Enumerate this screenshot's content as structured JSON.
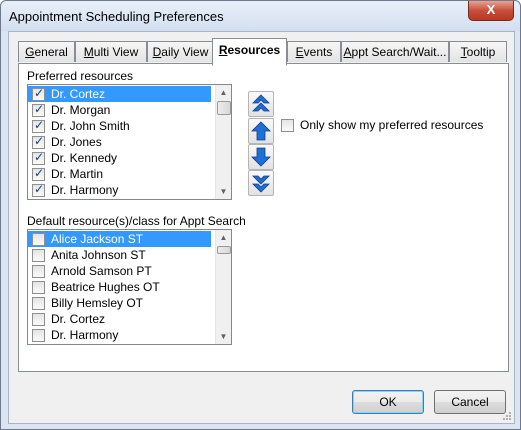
{
  "window": {
    "title": "Appointment Scheduling Preferences",
    "close_label": "X"
  },
  "tabs": [
    {
      "label": "General",
      "underline": "G",
      "rest": "eneral",
      "active": false
    },
    {
      "label": "Multi View",
      "underline": "M",
      "rest": "ulti View",
      "active": false
    },
    {
      "label": "Daily View",
      "underline": "D",
      "rest": "aily View",
      "active": false
    },
    {
      "label": "Resources",
      "underline": "R",
      "rest": "esources",
      "active": true
    },
    {
      "label": "Events",
      "underline": "E",
      "rest": "vents",
      "active": false
    },
    {
      "label": "Appt  Search/Wait...",
      "underline": "A",
      "rest": "ppt  Search/Wait...",
      "active": false
    },
    {
      "label": "Tooltip",
      "underline": "T",
      "rest": "ooltip",
      "active": false
    }
  ],
  "preferred": {
    "label": "Preferred resources",
    "items": [
      {
        "name": "Dr. Cortez",
        "checked": true,
        "selected": true
      },
      {
        "name": "Dr. Morgan",
        "checked": true,
        "selected": false
      },
      {
        "name": "Dr. John Smith",
        "checked": true,
        "selected": false
      },
      {
        "name": "Dr. Jones",
        "checked": true,
        "selected": false
      },
      {
        "name": "Dr. Kennedy",
        "checked": true,
        "selected": false
      },
      {
        "name": "Dr. Martin",
        "checked": true,
        "selected": false
      },
      {
        "name": "Dr. Harmony",
        "checked": true,
        "selected": false
      }
    ]
  },
  "default_resources": {
    "label": "Default resource(s)/class for Appt Search",
    "items": [
      {
        "name": "Alice Jackson ST",
        "checked": false,
        "selected": true
      },
      {
        "name": "Anita Johnson ST",
        "checked": false,
        "selected": false
      },
      {
        "name": "Arnold Samson PT",
        "checked": false,
        "selected": false
      },
      {
        "name": "Beatrice Hughes OT",
        "checked": false,
        "selected": false
      },
      {
        "name": "Billy Hemsley OT",
        "checked": false,
        "selected": false
      },
      {
        "name": "Dr. Cortez",
        "checked": false,
        "selected": false
      },
      {
        "name": "Dr. Harmony",
        "checked": false,
        "selected": false
      }
    ]
  },
  "only_preferred": {
    "label": "Only show my preferred resources",
    "checked": false
  },
  "move_buttons": [
    "move-to-top-icon",
    "move-up-icon",
    "move-down-icon",
    "move-to-bottom-icon"
  ],
  "footer": {
    "ok": "OK",
    "cancel": "Cancel"
  },
  "colors": {
    "selection": "#3399ff",
    "arrow_blue": "#1f6fd6"
  }
}
